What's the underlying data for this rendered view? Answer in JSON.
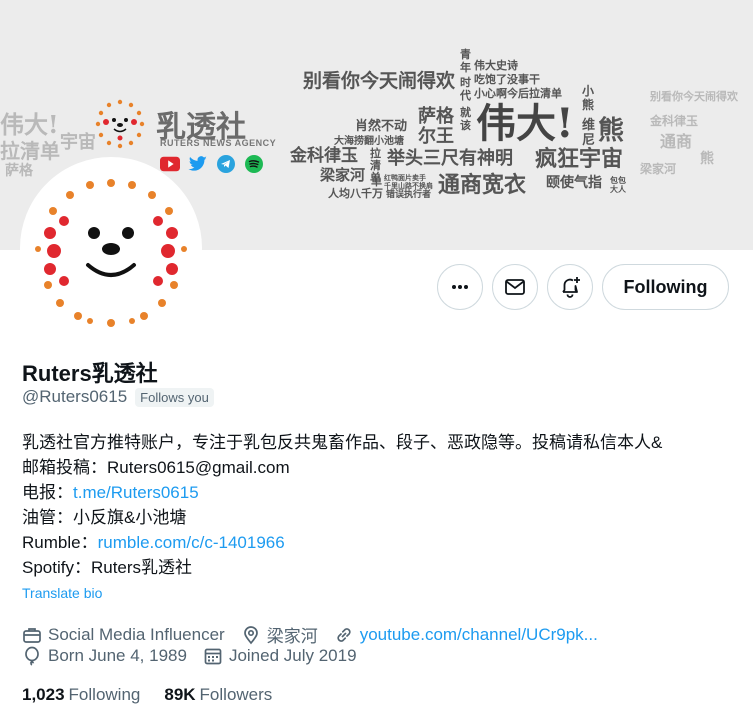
{
  "banner": {
    "brand_title": "乳透社",
    "brand_subtitle": "RUTERS NEWS AGENCY",
    "socials": [
      "youtube-icon",
      "twitter-icon",
      "telegram-icon",
      "spotify-icon"
    ],
    "cloud_words": [
      "别看你今天闹得欢",
      "青年",
      "伟大史诗",
      "时代",
      "吃饱了没事干",
      "小心啊今后拉清单",
      "萨格",
      "尔王",
      "就该",
      "伟大!",
      "熊",
      "维尼",
      "小熊",
      "肖然不动",
      "大海捞翻小池塘",
      "金科律玉",
      "拉清单",
      "举头三尺有神明",
      "疯狂宇宙",
      "梁家河",
      "单",
      "红鸭面片卖手",
      "千里山路不换肩",
      "通商宽衣",
      "颐使气指",
      "包包大人",
      "人均八千万",
      "错误执行者"
    ],
    "watermark": [
      "别看你今天闹得欢",
      "伟大!",
      "熊",
      "宇宙",
      "通商",
      "拉清单",
      "金科律玉",
      "萨格",
      "梁家河"
    ]
  },
  "profile": {
    "name": "Ruters乳透社",
    "handle": "@Ruters0615",
    "follows_you": "Follows you",
    "follow_button": "Following",
    "bio": {
      "line1": "乳透社官方推特账户，专注于乳包反共鬼畜作品、段子、恶政隐等。投稿请私信本人&",
      "line2": "邮箱投稿：Ruters0615@gmail.com",
      "telegram_label": "电报：",
      "telegram_link": "t.me/Ruters0615",
      "youtube_line": "油管：小反旗&小池塘",
      "rumble_label": "Rumble：",
      "rumble_link": "rumble.com/c/c-1401966",
      "spotify_line": "Spotify：Ruters乳透社"
    },
    "translate": "Translate bio",
    "category": "Social Media Influencer",
    "location": "梁家河",
    "website": "youtube.com/channel/UCr9pk...",
    "born": "Born June 4, 1989",
    "joined": "Joined July 2019",
    "following_count": "1,023",
    "following_label": "Following",
    "followers_count": "89K",
    "followers_label": "Followers"
  },
  "colors": {
    "link": "#1d9bf0",
    "secondary_text": "#536471",
    "banner_bg": "#ececec",
    "brand_red": "#e0282f",
    "brand_orange": "#e8822a"
  }
}
